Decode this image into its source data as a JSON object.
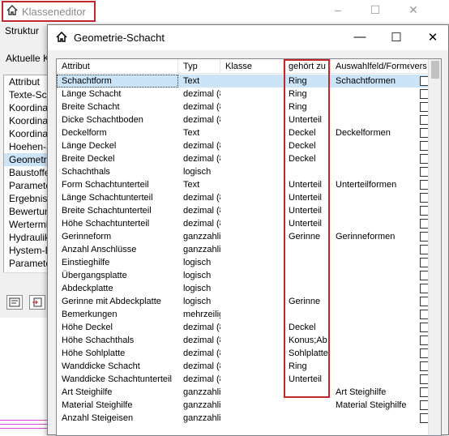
{
  "back_window": {
    "title": "Klasseneditor",
    "struktur_label": "Struktur",
    "aktuelle_label": "Aktuelle Kl",
    "min_icon": "–",
    "max_icon": "☐",
    "close_icon": "✕",
    "list_items": [
      {
        "label": "Attribut",
        "selected": false
      },
      {
        "label": "Texte-Scha",
        "selected": false
      },
      {
        "label": "Koordinate",
        "selected": false
      },
      {
        "label": "Koordinate",
        "selected": false
      },
      {
        "label": "Koordinate",
        "selected": false
      },
      {
        "label": "Hoehen-Sc",
        "selected": false
      },
      {
        "label": "Geometrie-S",
        "selected": true
      },
      {
        "label": "Baustoffe-S",
        "selected": false
      },
      {
        "label": "Parameter-",
        "selected": false
      },
      {
        "label": "Ergebnisse",
        "selected": false
      },
      {
        "label": "Bewertung",
        "selected": false
      },
      {
        "label": "Wertermittl",
        "selected": false
      },
      {
        "label": "Hydraulik-S",
        "selected": false
      },
      {
        "label": "Hystem-Ex",
        "selected": false
      },
      {
        "label": "Parameter",
        "selected": false
      }
    ]
  },
  "dialog": {
    "title": "Geometrie-Schacht",
    "min_icon": "—",
    "max_icon": "☐",
    "close_icon": "✕",
    "columns": {
      "attribut": "Attribut",
      "typ": "Typ",
      "klasse": "Klasse",
      "gehoert_zu": "gehört zu",
      "auswahlfeld": "Auswahlfeld/Formel",
      "vers": "vers"
    },
    "rows": [
      {
        "attribut": "Schachtform",
        "typ": "Text",
        "klasse": "",
        "gehoert_zu": "Ring",
        "auswahlfeld": "Schachtformen",
        "selected": true
      },
      {
        "attribut": "Länge Schacht",
        "typ": "dezimal (8",
        "klasse": "",
        "gehoert_zu": "Ring",
        "auswahlfeld": ""
      },
      {
        "attribut": "Breite Schacht",
        "typ": "dezimal (8",
        "klasse": "",
        "gehoert_zu": "Ring",
        "auswahlfeld": ""
      },
      {
        "attribut": "Dicke Schachtboden",
        "typ": "dezimal (8",
        "klasse": "",
        "gehoert_zu": "Unterteil",
        "auswahlfeld": ""
      },
      {
        "attribut": "Deckelform",
        "typ": "Text",
        "klasse": "",
        "gehoert_zu": "Deckel",
        "auswahlfeld": "Deckelformen"
      },
      {
        "attribut": "Länge Deckel",
        "typ": "dezimal (8",
        "klasse": "",
        "gehoert_zu": "Deckel",
        "auswahlfeld": ""
      },
      {
        "attribut": "Breite Deckel",
        "typ": "dezimal (8",
        "klasse": "",
        "gehoert_zu": "Deckel",
        "auswahlfeld": ""
      },
      {
        "attribut": "Schachthals",
        "typ": "logisch",
        "klasse": "",
        "gehoert_zu": "",
        "auswahlfeld": ""
      },
      {
        "attribut": "Form Schachtunterteil",
        "typ": "Text",
        "klasse": "",
        "gehoert_zu": "Unterteil",
        "auswahlfeld": "Unterteilformen"
      },
      {
        "attribut": "Länge Schachtunterteil",
        "typ": "dezimal (8",
        "klasse": "",
        "gehoert_zu": "Unterteil",
        "auswahlfeld": ""
      },
      {
        "attribut": "Breite Schachtunterteil",
        "typ": "dezimal (8",
        "klasse": "",
        "gehoert_zu": "Unterteil",
        "auswahlfeld": ""
      },
      {
        "attribut": "Höhe Schachtunterteil",
        "typ": "dezimal (8",
        "klasse": "",
        "gehoert_zu": "Unterteil",
        "auswahlfeld": ""
      },
      {
        "attribut": "Gerinneform",
        "typ": "ganzzahlig",
        "klasse": "",
        "gehoert_zu": "Gerinne",
        "auswahlfeld": "Gerinneformen"
      },
      {
        "attribut": "Anzahl Anschlüsse",
        "typ": "ganzzahlig",
        "klasse": "",
        "gehoert_zu": "",
        "auswahlfeld": ""
      },
      {
        "attribut": "Einstieghilfe",
        "typ": "logisch",
        "klasse": "",
        "gehoert_zu": "",
        "auswahlfeld": ""
      },
      {
        "attribut": "Übergangsplatte",
        "typ": "logisch",
        "klasse": "",
        "gehoert_zu": "",
        "auswahlfeld": ""
      },
      {
        "attribut": "Abdeckplatte",
        "typ": "logisch",
        "klasse": "",
        "gehoert_zu": "",
        "auswahlfeld": ""
      },
      {
        "attribut": "Gerinne mit Abdeckplatte",
        "typ": "logisch",
        "klasse": "",
        "gehoert_zu": "Gerinne",
        "auswahlfeld": ""
      },
      {
        "attribut": "Bemerkungen",
        "typ": "mehrzeilig",
        "klasse": "",
        "gehoert_zu": "",
        "auswahlfeld": ""
      },
      {
        "attribut": "Höhe Deckel",
        "typ": "dezimal (8",
        "klasse": "",
        "gehoert_zu": "Deckel",
        "auswahlfeld": ""
      },
      {
        "attribut": "Höhe Schachthals",
        "typ": "dezimal (8",
        "klasse": "",
        "gehoert_zu": "Konus;Ab",
        "auswahlfeld": ""
      },
      {
        "attribut": "Höhe Sohlplatte",
        "typ": "dezimal (8",
        "klasse": "",
        "gehoert_zu": "Sohlplatte",
        "auswahlfeld": ""
      },
      {
        "attribut": "Wanddicke Schacht",
        "typ": "dezimal (8",
        "klasse": "",
        "gehoert_zu": "Ring",
        "auswahlfeld": ""
      },
      {
        "attribut": "Wanddicke Schachtunterteil",
        "typ": "dezimal (8",
        "klasse": "",
        "gehoert_zu": "Unterteil",
        "auswahlfeld": ""
      },
      {
        "attribut": "Art Steighilfe",
        "typ": "ganzzahlig",
        "klasse": "",
        "gehoert_zu": "",
        "auswahlfeld": "Art Steighilfe"
      },
      {
        "attribut": "Material Steighilfe",
        "typ": "ganzzahlig",
        "klasse": "",
        "gehoert_zu": "",
        "auswahlfeld": "Material Steighilfe"
      },
      {
        "attribut": "Anzahl Steigeisen",
        "typ": "ganzzahlig",
        "klasse": "",
        "gehoert_zu": "",
        "auswahlfeld": ""
      }
    ]
  },
  "colors": {
    "highlight_red": "#c0282d",
    "selection_blue": "#cce4f7"
  }
}
